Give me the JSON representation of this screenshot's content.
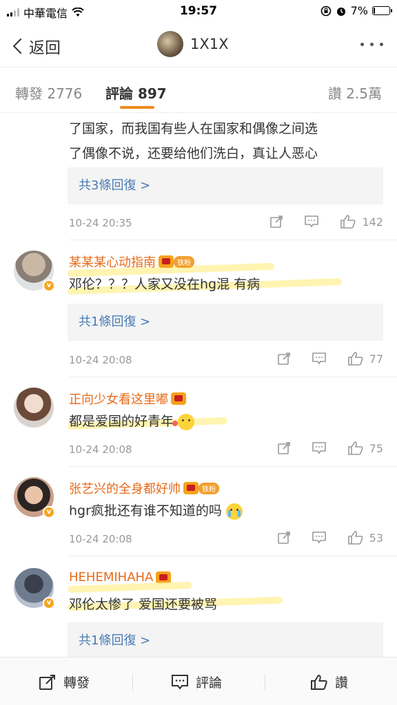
{
  "status_bar": {
    "carrier": "中華電信",
    "time": "19:57",
    "battery": "7%",
    "battery_level": 0.07
  },
  "nav": {
    "back_label": "返回",
    "title": "1X1X"
  },
  "tabs": {
    "repost": "轉發 2776",
    "comments": "評論 897",
    "likes": "讚 2.5萬"
  },
  "comments": [
    {
      "text_lines": [
        "了国家，而我国有些人在国家和偶像之间选",
        "了偶像不说，还要给他们洗白，真让人恶心"
      ],
      "replies": "共3條回復 >",
      "time": "10-24 20:35",
      "likes": "142"
    },
    {
      "username": "某某某心动指南",
      "badge": "铁粉",
      "text": "邓伦？？？人家又没在hg混  有病",
      "replies": "共1條回復 >",
      "time": "10-24 20:08",
      "likes": "77"
    },
    {
      "username": "正向少女看这里嘟",
      "text": "都是爱国的好青年",
      "time": "10-24 20:08",
      "likes": "75"
    },
    {
      "username": "张艺兴的全身都好帅",
      "badge": "铁粉",
      "text": "hgr疯批还有谁不知道的吗",
      "time": "10-24 20:08",
      "likes": "53"
    },
    {
      "username": "HEHEMIHAHA",
      "text": "邓伦太惨了 爱国还要被骂",
      "replies": "共1條回復 >"
    }
  ],
  "bottom_bar": {
    "repost": "轉發",
    "comment": "評論",
    "like": "讚"
  },
  "colors": {
    "accent": "#f08a1c",
    "username": "#e86a17",
    "link": "#4a7bb5"
  }
}
